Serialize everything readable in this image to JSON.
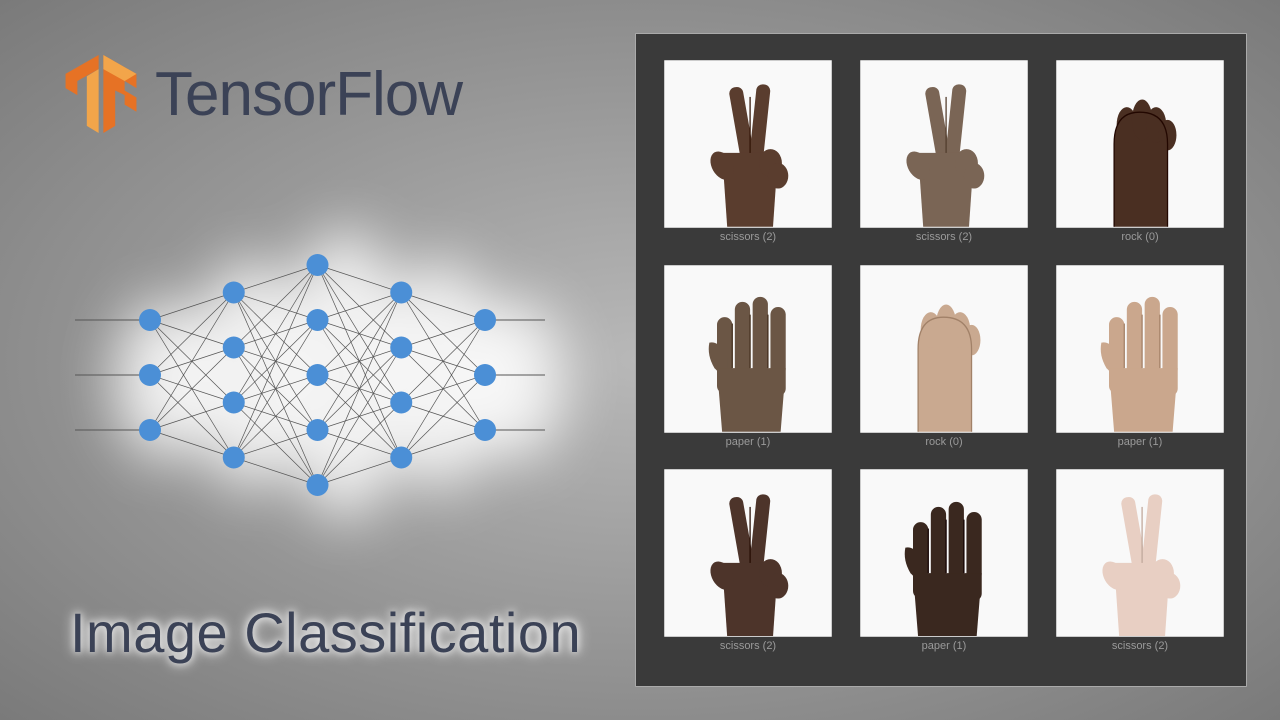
{
  "brand": {
    "name": "TensorFlow"
  },
  "subtitle": "Image Classification",
  "grid": {
    "items": [
      {
        "label": "scissors (2)",
        "skin": "#5a3d2e",
        "gesture": "scissors"
      },
      {
        "label": "scissors (2)",
        "skin": "#7a6555",
        "gesture": "scissors"
      },
      {
        "label": "rock (0)",
        "skin": "#4a2f22",
        "gesture": "rock"
      },
      {
        "label": "paper (1)",
        "skin": "#6b5645",
        "gesture": "paper"
      },
      {
        "label": "rock (0)",
        "skin": "#c9a990",
        "gesture": "rock"
      },
      {
        "label": "paper (1)",
        "skin": "#caa78d",
        "gesture": "paper"
      },
      {
        "label": "scissors (2)",
        "skin": "#4d342a",
        "gesture": "scissors"
      },
      {
        "label": "paper (1)",
        "skin": "#3a281f",
        "gesture": "paper"
      },
      {
        "label": "scissors (2)",
        "skin": "#e8cfc3",
        "gesture": "scissors"
      }
    ]
  },
  "nn": {
    "layers": [
      3,
      4,
      5,
      4,
      3
    ],
    "node_color": "#4b8fd6"
  }
}
